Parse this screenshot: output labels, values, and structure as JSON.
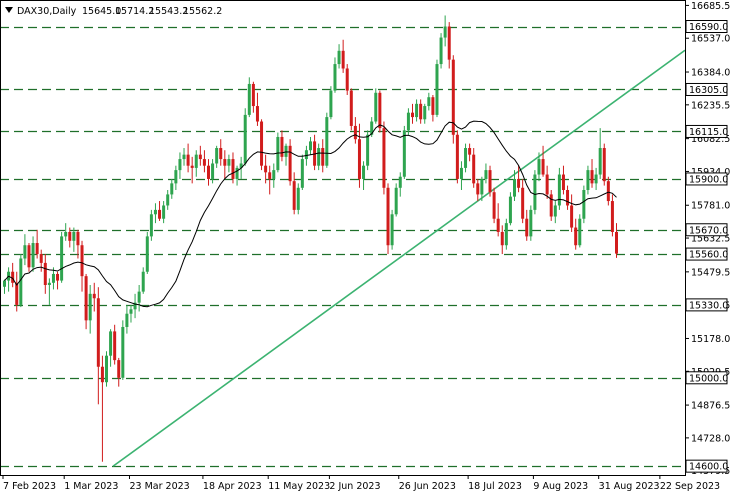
{
  "chart_data": {
    "type": "candlestick",
    "symbol": "DAX30,Daily",
    "ohlc_header": [
      "15645.0",
      "15714.2",
      "15543.2",
      "15562.2"
    ],
    "ylim": [
      14560,
      16710
    ],
    "y_ticks": [
      "16685.5",
      "16537.0",
      "16384.0",
      "16235.5",
      "16082.5",
      "15934.0",
      "15781.0",
      "15632.5",
      "15479.5",
      "15330.5",
      "15178.0",
      "15029.5",
      "14876.5",
      "14728.0",
      "14579.5"
    ],
    "x_ticks": [
      {
        "bar": 0,
        "label": "7 Feb 2023"
      },
      {
        "bar": 15,
        "label": "1 Mar 2023"
      },
      {
        "bar": 31,
        "label": "23 Mar 2023"
      },
      {
        "bar": 49,
        "label": "18 Apr 2023"
      },
      {
        "bar": 65,
        "label": "11 May 2023"
      },
      {
        "bar": 80,
        "label": "2 Jun 2023"
      },
      {
        "bar": 97,
        "label": "26 Jun 2023"
      },
      {
        "bar": 114,
        "label": "18 Jul 2023"
      },
      {
        "bar": 130,
        "label": "9 Aug 2023"
      },
      {
        "bar": 146,
        "label": "31 Aug 2023"
      },
      {
        "bar": 161,
        "label": "22 Sep 2023"
      }
    ],
    "levels": [
      {
        "value": 16590.0,
        "label": "16590.0"
      },
      {
        "value": 16305.0,
        "label": "16305.0"
      },
      {
        "value": 16115.0,
        "label": "16115.0"
      },
      {
        "value": 15900.0,
        "label": "15900.0"
      },
      {
        "value": 15670.0,
        "label": "15670.0"
      },
      {
        "value": 15560.0,
        "label": "15560.0"
      },
      {
        "value": 15330.0,
        "label": "15330.0"
      },
      {
        "value": 15000.0,
        "label": "15000.0"
      },
      {
        "value": 14600.0,
        "label": "14600.0"
      }
    ],
    "trendline": {
      "start_bar": 27,
      "start_value": 14600,
      "end_bar": 164,
      "end_value": 16440
    },
    "colors": {
      "up": "#2ea44f",
      "down": "#d11c1c",
      "ma": "#000000",
      "level": "#1f6f2a",
      "trend": "#3cb371",
      "label_bg": "#ffffff",
      "label_border": "#000000"
    },
    "candles": [
      [
        15412,
        15445,
        15380,
        15440
      ],
      [
        15440,
        15500,
        15390,
        15480
      ],
      [
        15480,
        15520,
        15410,
        15430
      ],
      [
        15430,
        15480,
        15300,
        15330
      ],
      [
        15330,
        15560,
        15320,
        15540
      ],
      [
        15540,
        15650,
        15510,
        15600
      ],
      [
        15600,
        15610,
        15480,
        15500
      ],
      [
        15500,
        15640,
        15480,
        15610
      ],
      [
        15610,
        15670,
        15540,
        15560
      ],
      [
        15560,
        15580,
        15480,
        15520
      ],
      [
        15520,
        15560,
        15380,
        15420
      ],
      [
        15420,
        15450,
        15330,
        15430
      ],
      [
        15430,
        15500,
        15400,
        15470
      ],
      [
        15470,
        15480,
        15400,
        15440
      ],
      [
        15440,
        15660,
        15430,
        15640
      ],
      [
        15640,
        15700,
        15620,
        15660
      ],
      [
        15660,
        15680,
        15590,
        15620
      ],
      [
        15620,
        15680,
        15570,
        15660
      ],
      [
        15660,
        15670,
        15540,
        15600
      ],
      [
        15600,
        15620,
        15390,
        15460
      ],
      [
        15460,
        15470,
        15220,
        15260
      ],
      [
        15260,
        15420,
        15200,
        15380
      ],
      [
        15380,
        15430,
        15300,
        15360
      ],
      [
        15360,
        15410,
        14880,
        15050
      ],
      [
        15050,
        15100,
        14620,
        14980
      ],
      [
        14980,
        15120,
        14960,
        15100
      ],
      [
        15100,
        15220,
        15050,
        15210
      ],
      [
        15210,
        15240,
        15060,
        15080
      ],
      [
        15080,
        15090,
        14960,
        15000
      ],
      [
        15000,
        15260,
        14990,
        15230
      ],
      [
        15230,
        15330,
        15200,
        15290
      ],
      [
        15290,
        15330,
        15250,
        15310
      ],
      [
        15310,
        15380,
        15270,
        15340
      ],
      [
        15340,
        15420,
        15300,
        15390
      ],
      [
        15390,
        15500,
        15380,
        15480
      ],
      [
        15480,
        15660,
        15470,
        15640
      ],
      [
        15640,
        15760,
        15620,
        15740
      ],
      [
        15740,
        15790,
        15700,
        15760
      ],
      [
        15760,
        15800,
        15710,
        15720
      ],
      [
        15720,
        15800,
        15700,
        15780
      ],
      [
        15780,
        15850,
        15760,
        15830
      ],
      [
        15830,
        15900,
        15810,
        15880
      ],
      [
        15880,
        15960,
        15850,
        15940
      ],
      [
        15940,
        16020,
        15900,
        15990
      ],
      [
        15990,
        16040,
        15960,
        16010
      ],
      [
        16010,
        16060,
        15930,
        15960
      ],
      [
        15960,
        16000,
        15880,
        15950
      ],
      [
        15950,
        16030,
        15910,
        16010
      ],
      [
        16010,
        16050,
        15960,
        15990
      ],
      [
        15990,
        16030,
        15930,
        15960
      ],
      [
        15960,
        15990,
        15870,
        15900
      ],
      [
        15900,
        15990,
        15880,
        15970
      ],
      [
        15970,
        16050,
        15950,
        16040
      ],
      [
        16040,
        16080,
        15960,
        15990
      ],
      [
        15990,
        16030,
        15900,
        15960
      ],
      [
        15960,
        16010,
        15930,
        15990
      ],
      [
        15990,
        16020,
        15880,
        15900
      ],
      [
        15900,
        15960,
        15870,
        15950
      ],
      [
        15950,
        16000,
        15900,
        15970
      ],
      [
        15970,
        16220,
        15960,
        16190
      ],
      [
        16190,
        16360,
        16180,
        16330
      ],
      [
        16330,
        16340,
        16200,
        16230
      ],
      [
        16230,
        16290,
        16140,
        16160
      ],
      [
        16160,
        16170,
        15940,
        15960
      ],
      [
        15960,
        16010,
        15880,
        15930
      ],
      [
        15930,
        15960,
        15830,
        15900
      ],
      [
        15900,
        15970,
        15860,
        15940
      ],
      [
        15940,
        16110,
        15930,
        16090
      ],
      [
        16090,
        16120,
        15980,
        16000
      ],
      [
        16000,
        16060,
        15960,
        16050
      ],
      [
        16050,
        16080,
        15870,
        15890
      ],
      [
        15890,
        15930,
        15740,
        15760
      ],
      [
        15760,
        15880,
        15740,
        15860
      ],
      [
        15860,
        16010,
        15850,
        15990
      ],
      [
        15990,
        16050,
        15960,
        16030
      ],
      [
        16030,
        16090,
        16010,
        16070
      ],
      [
        16070,
        16100,
        15940,
        15960
      ],
      [
        15960,
        16060,
        15940,
        16040
      ],
      [
        16040,
        16080,
        15930,
        15960
      ],
      [
        15960,
        16200,
        15950,
        16180
      ],
      [
        16180,
        16320,
        16170,
        16300
      ],
      [
        16300,
        16450,
        16290,
        16420
      ],
      [
        16420,
        16510,
        16400,
        16480
      ],
      [
        16480,
        16530,
        16380,
        16400
      ],
      [
        16400,
        16420,
        16280,
        16300
      ],
      [
        16300,
        16310,
        16120,
        16140
      ],
      [
        16140,
        16180,
        16060,
        16080
      ],
      [
        16080,
        16150,
        15860,
        15900
      ],
      [
        15900,
        15980,
        15850,
        15960
      ],
      [
        15960,
        16120,
        15940,
        16100
      ],
      [
        16100,
        16180,
        16090,
        16160
      ],
      [
        16160,
        16310,
        16150,
        16290
      ],
      [
        16290,
        16300,
        16110,
        16130
      ],
      [
        16130,
        16160,
        15830,
        15860
      ],
      [
        15860,
        15880,
        15560,
        15600
      ],
      [
        15600,
        15760,
        15580,
        15740
      ],
      [
        15740,
        15880,
        15730,
        15860
      ],
      [
        15860,
        15930,
        15820,
        15910
      ],
      [
        15910,
        16140,
        15900,
        16120
      ],
      [
        16120,
        16220,
        16100,
        16200
      ],
      [
        16200,
        16240,
        16150,
        16180
      ],
      [
        16180,
        16260,
        16160,
        16240
      ],
      [
        16240,
        16260,
        16150,
        16170
      ],
      [
        16170,
        16240,
        16150,
        16230
      ],
      [
        16230,
        16290,
        16210,
        16270
      ],
      [
        16270,
        16280,
        16160,
        16190
      ],
      [
        16190,
        16440,
        16180,
        16420
      ],
      [
        16420,
        16560,
        16400,
        16540
      ],
      [
        16540,
        16640,
        16500,
        16590
      ],
      [
        16590,
        16610,
        16400,
        16440
      ],
      [
        16440,
        16460,
        16060,
        16100
      ],
      [
        16100,
        16120,
        15880,
        15900
      ],
      [
        15900,
        15980,
        15850,
        15950
      ],
      [
        15950,
        16060,
        15930,
        16040
      ],
      [
        16040,
        16060,
        15980,
        16010
      ],
      [
        16010,
        16040,
        15860,
        15880
      ],
      [
        15880,
        15900,
        15800,
        15830
      ],
      [
        15830,
        15910,
        15800,
        15900
      ],
      [
        15900,
        15970,
        15880,
        15940
      ],
      [
        15940,
        15960,
        15820,
        15840
      ],
      [
        15840,
        15860,
        15700,
        15720
      ],
      [
        15720,
        15790,
        15640,
        15660
      ],
      [
        15660,
        15690,
        15560,
        15600
      ],
      [
        15600,
        15720,
        15580,
        15700
      ],
      [
        15700,
        15840,
        15690,
        15820
      ],
      [
        15820,
        15940,
        15800,
        15900
      ],
      [
        15900,
        15960,
        15840,
        15860
      ],
      [
        15860,
        15900,
        15700,
        15720
      ],
      [
        15720,
        15760,
        15620,
        15640
      ],
      [
        15640,
        15780,
        15620,
        15760
      ],
      [
        15760,
        15940,
        15740,
        15920
      ],
      [
        15920,
        16020,
        15890,
        15990
      ],
      [
        15990,
        16050,
        15910,
        15920
      ],
      [
        15920,
        15960,
        15810,
        15830
      ],
      [
        15830,
        15850,
        15710,
        15730
      ],
      [
        15730,
        15800,
        15700,
        15780
      ],
      [
        15780,
        15950,
        15760,
        15920
      ],
      [
        15920,
        15960,
        15830,
        15850
      ],
      [
        15850,
        15870,
        15760,
        15780
      ],
      [
        15780,
        15830,
        15660,
        15680
      ],
      [
        15680,
        15720,
        15580,
        15600
      ],
      [
        15600,
        15740,
        15590,
        15720
      ],
      [
        15720,
        15870,
        15700,
        15850
      ],
      [
        15850,
        15960,
        15830,
        15940
      ],
      [
        15940,
        15990,
        15860,
        15880
      ],
      [
        15880,
        15950,
        15850,
        15920
      ],
      [
        15920,
        16130,
        15900,
        16040
      ],
      [
        16040,
        16060,
        15870,
        15890
      ],
      [
        15890,
        15910,
        15780,
        15800
      ],
      [
        15800,
        15830,
        15640,
        15660
      ],
      [
        15660,
        15700,
        15543,
        15562
      ]
    ],
    "ma_window": 20
  }
}
